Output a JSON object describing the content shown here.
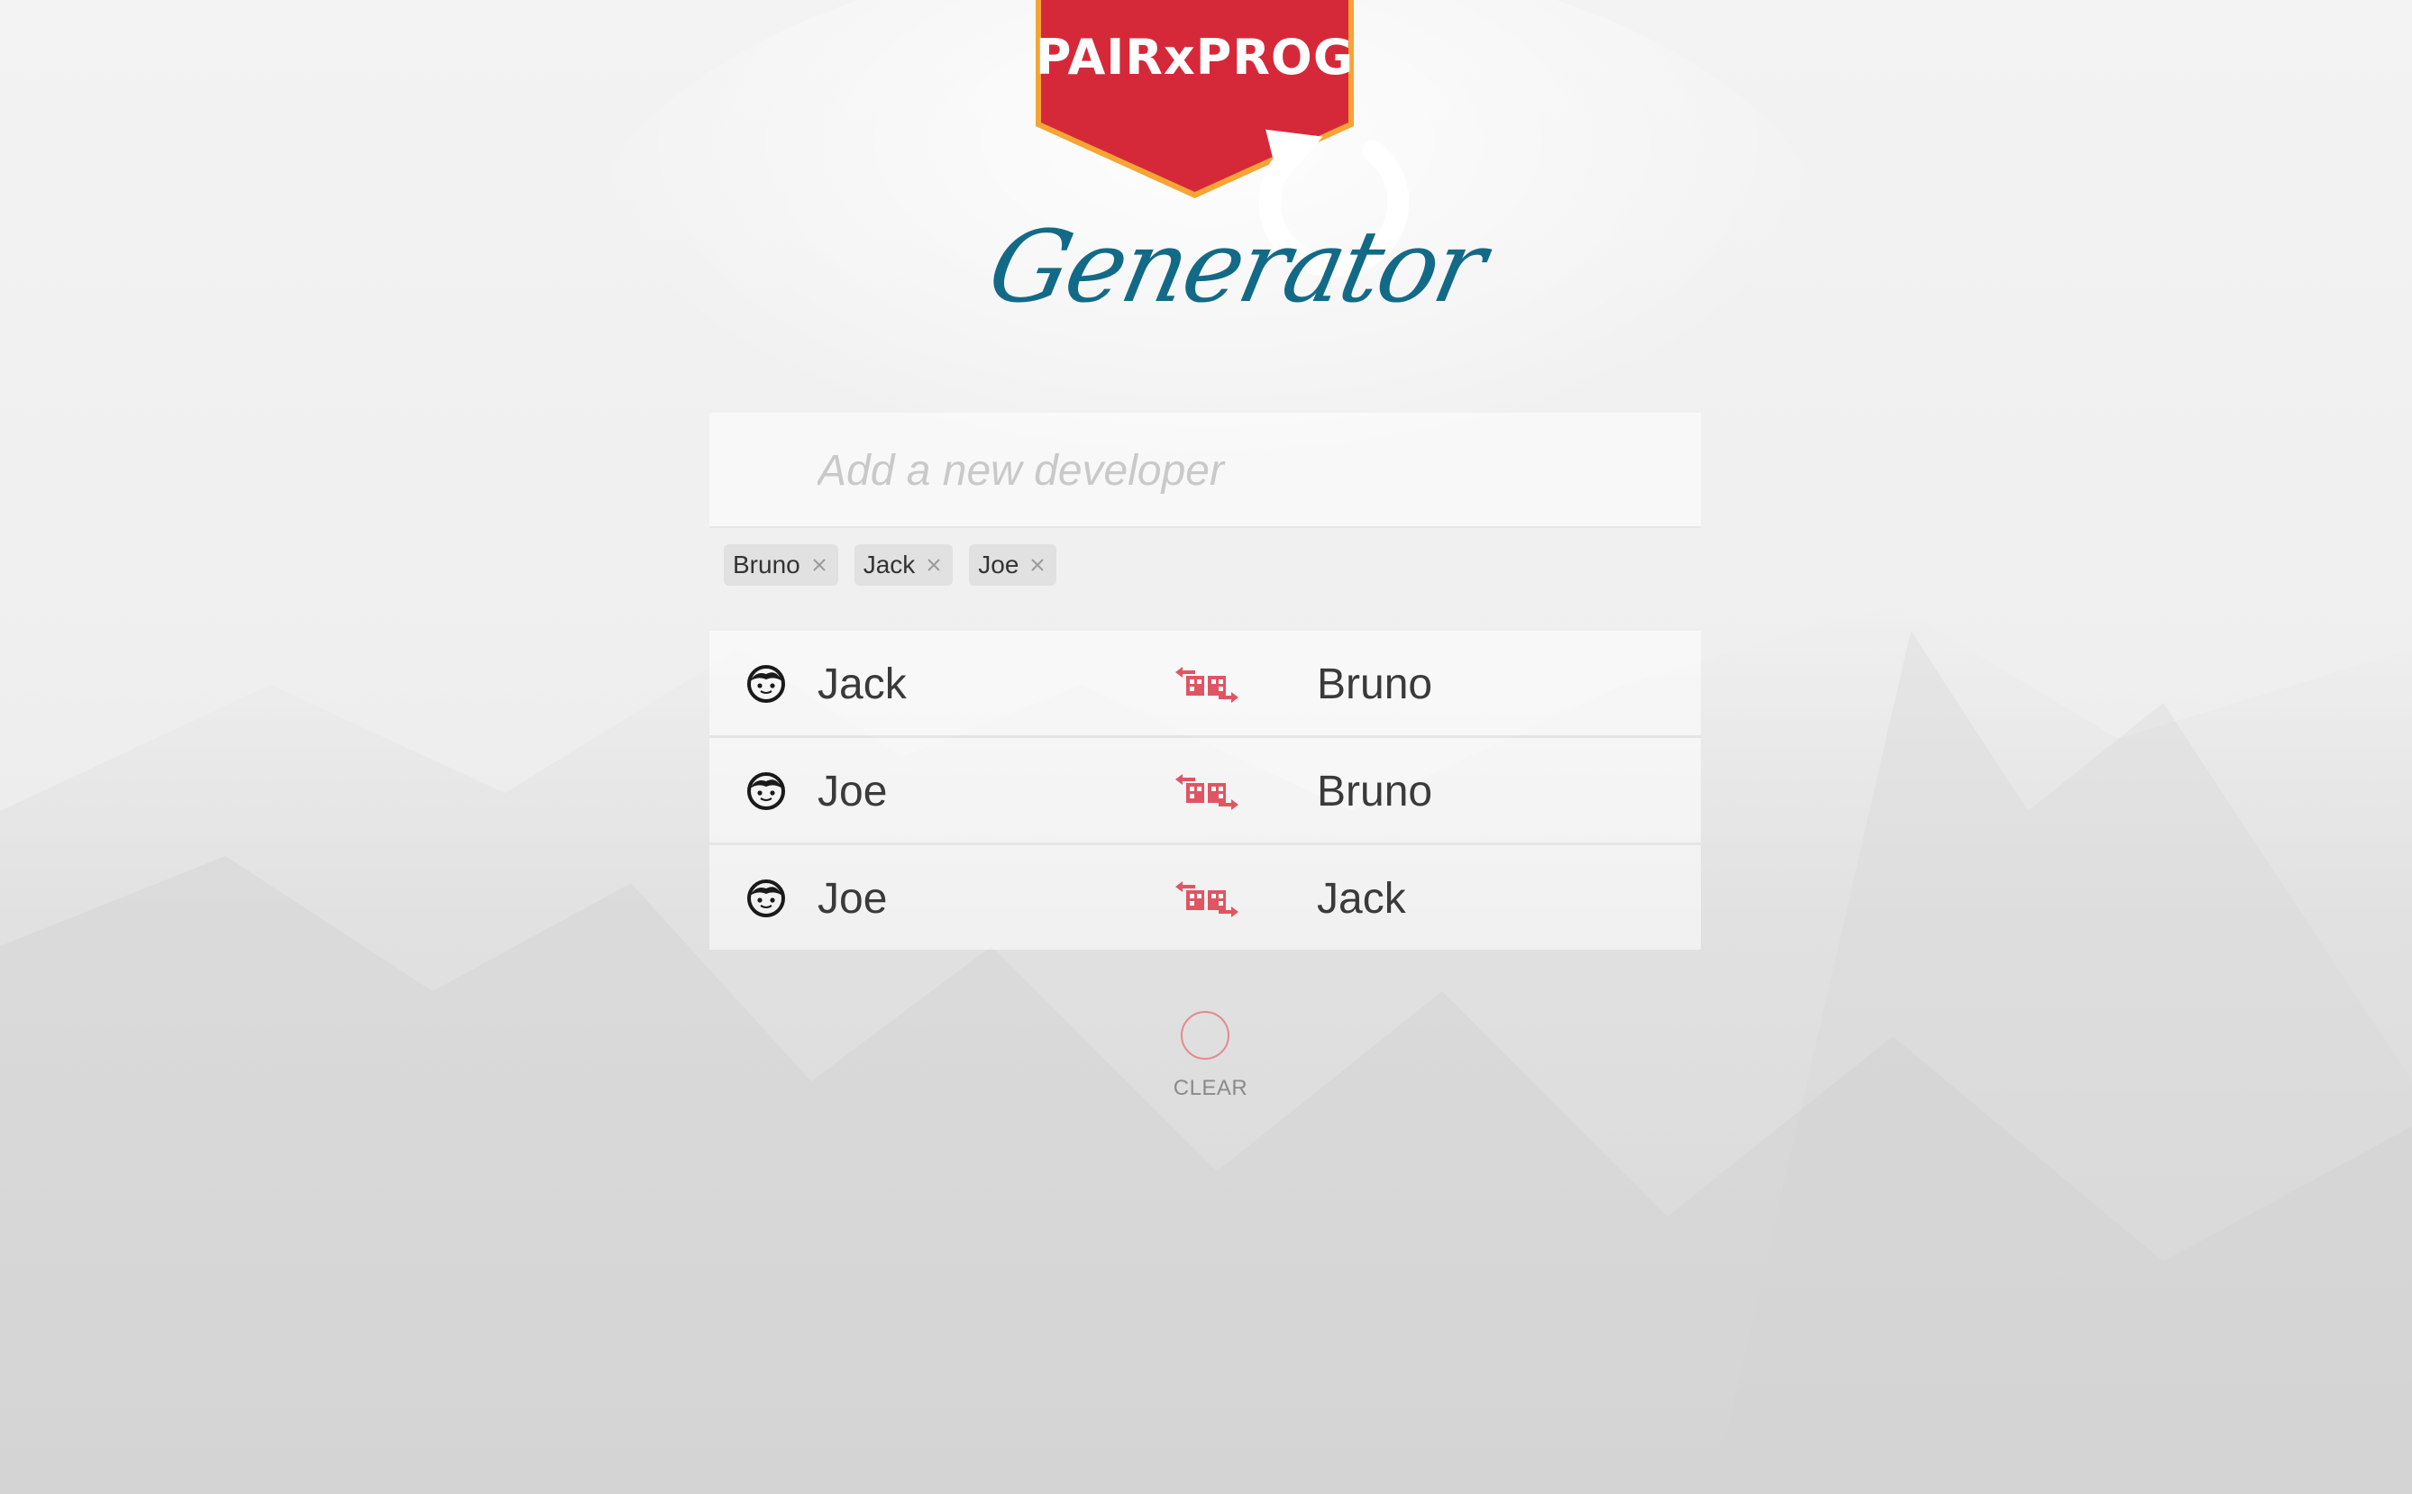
{
  "brand": {
    "title": "PAIRxPROG",
    "subtitle": "Generator",
    "badge_color": "#d5293a",
    "badge_border": "#f4a534",
    "subtitle_color": "#136a86"
  },
  "input": {
    "placeholder": "Add a new developer",
    "value": ""
  },
  "tags": [
    {
      "label": "Bruno"
    },
    {
      "label": "Jack"
    },
    {
      "label": "Joe"
    }
  ],
  "pairs": [
    {
      "developer_a": "Jack",
      "developer_b": "Bruno",
      "icon": "face-icon",
      "swap_icon": "swap-icon"
    },
    {
      "developer_a": "Joe",
      "developer_b": "Bruno",
      "icon": "face-icon",
      "swap_icon": "swap-icon"
    },
    {
      "developer_a": "Joe",
      "developer_b": "Jack",
      "icon": "face-icon",
      "swap_icon": "swap-icon"
    }
  ],
  "actions": {
    "clear_label": "CLEAR",
    "refresh_icon": "refresh-icon",
    "accent_color": "#e05563"
  }
}
